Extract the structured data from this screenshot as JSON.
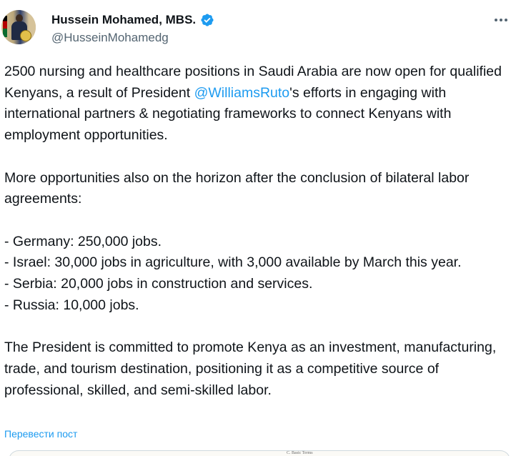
{
  "author": {
    "display_name": "Hussein Mohamed, MBS.",
    "handle": "@HusseinMohamedg",
    "verified": true,
    "verified_color": "#1d9bf0"
  },
  "more_icon": "more-horizontal-icon",
  "paragraph1": {
    "before": "2500 nursing and healthcare positions in Saudi Arabia are now open for qualified Kenyans, a result of President ",
    "mention": "@WilliamsRuto",
    "after": "'s efforts in engaging with international partners & negotiating frameworks to connect Kenyans with employment opportunities."
  },
  "paragraph2": "More opportunities also on the horizon after the conclusion of bilateral labor agreements:",
  "list_items": [
    "- Germany: 250,000 jobs.",
    "- Israel: 30,000 jobs in agriculture, with 3,000 available by March this year.",
    "- Serbia: 20,000 jobs in construction and services.",
    "- Russia: 10,000 jobs."
  ],
  "paragraph3": "The President is committed to promote Kenya as an investment, manufacturing, trade, and tourism destination, positioning it as a competitive source of professional, skilled, and semi-skilled labor.",
  "translate_link": "Перевести пост",
  "media_text": "C. Basic Terms",
  "colors": {
    "text": "#0f1419",
    "secondary": "#536471",
    "link": "#1d9bf0"
  }
}
